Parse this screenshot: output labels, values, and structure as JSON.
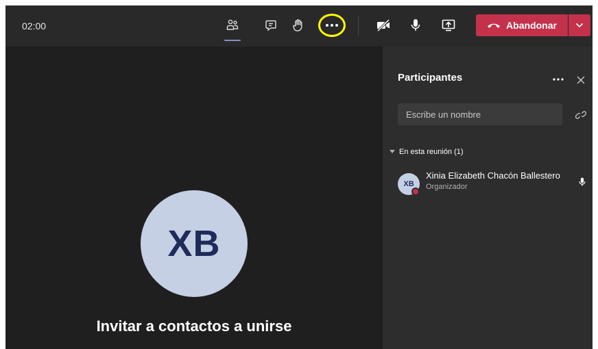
{
  "toolbar": {
    "timer": "02:00",
    "leave_label": "Abandonar",
    "colors": {
      "leave_bg": "#c4314b",
      "active_underline": "#8b8cc7",
      "highlight": "#ffff00"
    },
    "icons": [
      "people-icon",
      "chat-icon",
      "raise-hand-icon",
      "more-icon",
      "camera-off-icon",
      "microphone-icon",
      "share-screen-icon",
      "phone-hangup-icon",
      "chevron-down-icon"
    ]
  },
  "stage": {
    "avatar_initials": "XB",
    "invite_text": "Invitar a contactos a unirse"
  },
  "panel": {
    "title": "Participantes",
    "search_placeholder": "Escribe un nombre",
    "section_label": "En esta reunión (1)",
    "participants": [
      {
        "initials": "XB",
        "name": "Xinia Elizabeth Chacón Ballestero",
        "role": "Organizador"
      }
    ]
  }
}
